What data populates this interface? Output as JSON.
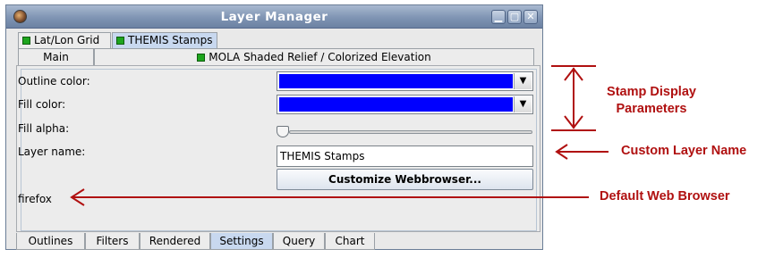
{
  "window": {
    "title": "Layer Manager",
    "minimize_glyph": "▁",
    "maximize_glyph": "▢",
    "close_glyph": "✕"
  },
  "top_tabs": [
    {
      "label": "Lat/Lon Grid",
      "indicator_color": "#1ea51e"
    },
    {
      "label": "THEMIS Stamps",
      "indicator_color": "#1ea51e",
      "selected": true
    }
  ],
  "sub_tabs": [
    {
      "label": "Main"
    },
    {
      "label": "MOLA Shaded Relief / Colorized Elevation",
      "indicator_color": "#1ea51e"
    }
  ],
  "settings": {
    "outline_color_label": "Outline color:",
    "outline_color_value": "#0000ff",
    "fill_color_label": "Fill color:",
    "fill_color_value": "#0000ff",
    "fill_alpha_label": "Fill alpha:",
    "fill_alpha_value": 0,
    "layer_name_label": "Layer name:",
    "layer_name_value": "THEMIS Stamps",
    "customize_button": "Customize Webbrowser...",
    "browser_value": "firefox",
    "dropdown_glyph": "▼"
  },
  "bottom_tabs": [
    {
      "label": "Outlines"
    },
    {
      "label": "Filters"
    },
    {
      "label": "Rendered"
    },
    {
      "label": "Settings",
      "selected": true
    },
    {
      "label": "Query"
    },
    {
      "label": "Chart"
    }
  ],
  "annotations": {
    "stamp_display_line1": "Stamp Display",
    "stamp_display_line2": "Parameters",
    "custom_layer_name": "Custom Layer Name",
    "default_web_browser": "Default Web Browser",
    "color": "#b01010"
  }
}
